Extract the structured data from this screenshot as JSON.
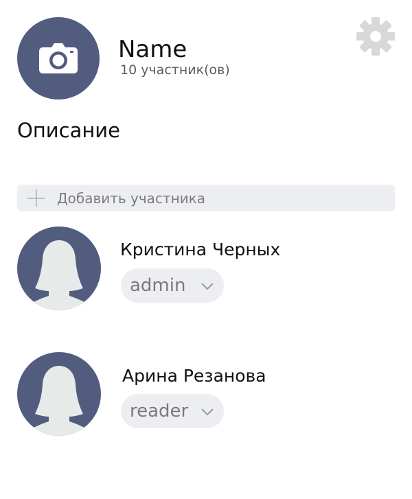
{
  "group": {
    "name": "Name",
    "member_count": "10 участник(ов)",
    "description": "Описание",
    "avatar_icon": "camera-icon",
    "settings_icon": "gear-icon"
  },
  "add_member": {
    "label": "Добавить участника",
    "icon": "plus-icon"
  },
  "members": [
    {
      "name": "Кристина Черных",
      "role": "admin",
      "avatar_icon": "user-silhouette-icon"
    },
    {
      "name": "Арина Резанова",
      "role": "reader",
      "avatar_icon": "user-silhouette-icon"
    }
  ],
  "colors": {
    "avatar_bg": "#525c7f",
    "pill_bg": "#eceef2",
    "muted_text": "#7a7a7a",
    "gear": "#d9d8d6"
  }
}
